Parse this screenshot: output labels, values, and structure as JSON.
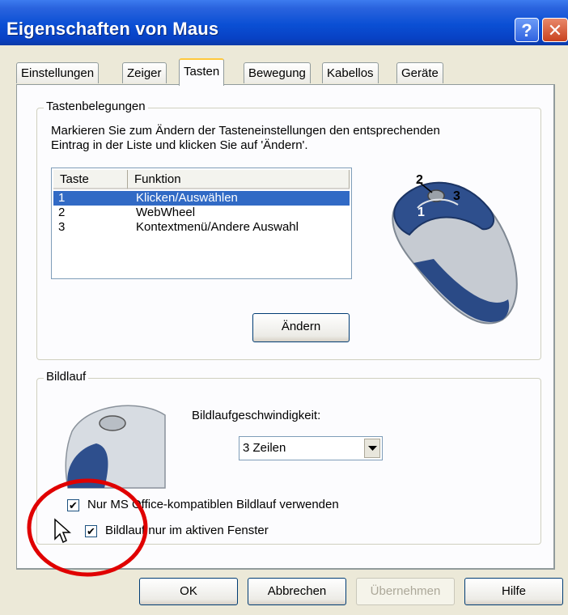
{
  "window": {
    "title": "Eigenschaften von Maus",
    "help_glyph": "?",
    "close_glyph": "✕"
  },
  "tabs": [
    {
      "label": "Einstellungen",
      "active": false
    },
    {
      "label": "Zeiger",
      "active": false
    },
    {
      "label": "Tasten",
      "active": true
    },
    {
      "label": "Bewegung",
      "active": false
    },
    {
      "label": "Kabellos",
      "active": false
    },
    {
      "label": "Geräte",
      "active": false
    }
  ],
  "buttons_group": {
    "title": "Tastenbelegungen",
    "description_line1": "Markieren Sie zum Ändern der Tasteneinstellungen den entsprechenden",
    "description_line2": "Eintrag in der Liste und klicken Sie auf 'Ändern'.",
    "columns": [
      "Taste",
      "Funktion"
    ],
    "rows": [
      {
        "key": "1",
        "function": "Klicken/Auswählen",
        "selected": true
      },
      {
        "key": "2",
        "function": "WebWheel",
        "selected": false
      },
      {
        "key": "3",
        "function": "Kontextmenü/Andere Auswahl",
        "selected": false
      }
    ],
    "change_button": "Ändern",
    "mouse_labels": [
      "1",
      "2",
      "3"
    ]
  },
  "scroll_group": {
    "title": "Bildlauf",
    "speed_label": "Bildlaufgeschwindigkeit:",
    "speed_value": "3 Zeilen",
    "checkboxes": [
      {
        "label": "Nur MS Office-kompatiblen Bildlauf verwenden",
        "checked": true
      },
      {
        "label": "Bildlauf nur im aktiven Fenster",
        "checked": true
      }
    ]
  },
  "footer": {
    "ok": "OK",
    "cancel": "Abbrechen",
    "apply": "Übernehmen",
    "help": "Hilfe"
  },
  "colors": {
    "title_bar": "#0a4fd4",
    "selection": "#316ac5",
    "highlight_circle": "#e00000"
  }
}
